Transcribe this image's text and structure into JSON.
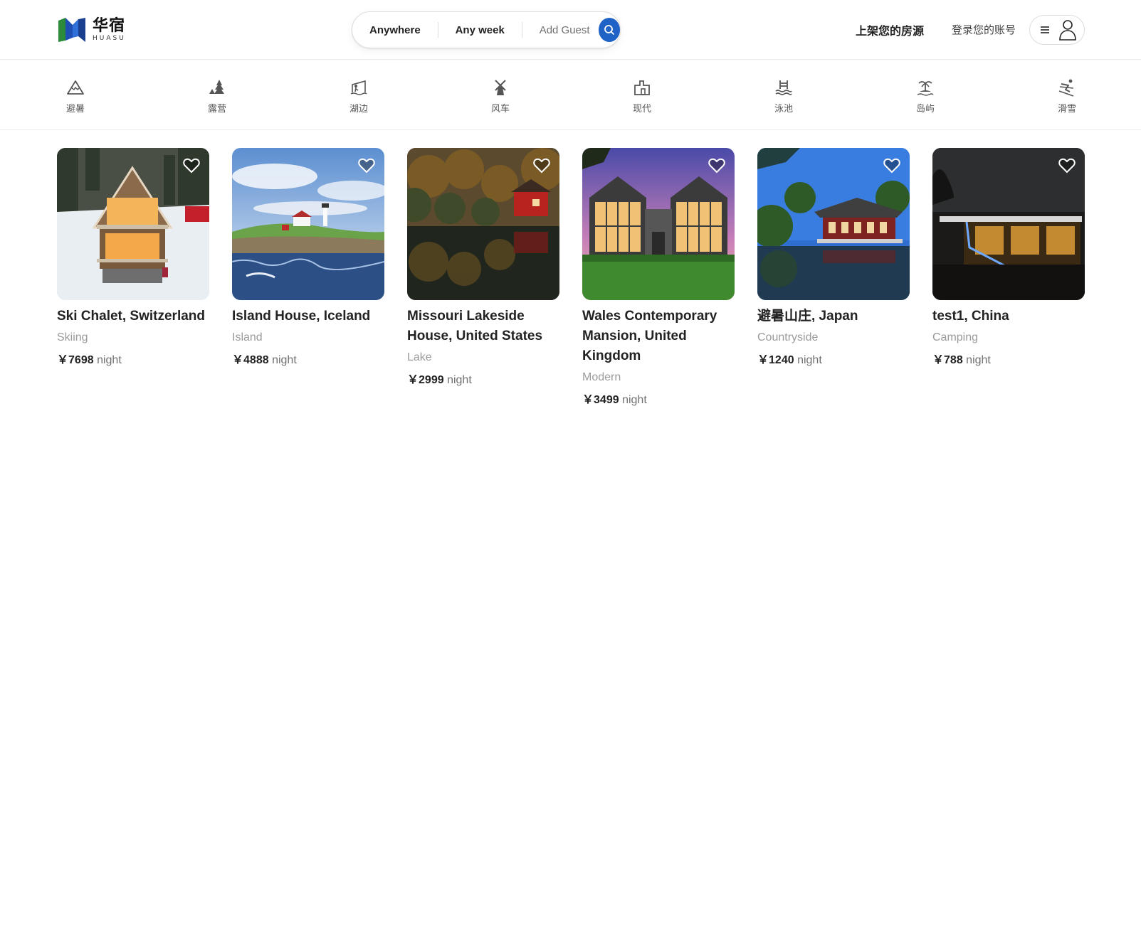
{
  "brand": {
    "name_cn": "华宿",
    "name_en": "HUASU"
  },
  "search": {
    "where": "Anywhere",
    "when": "Any week",
    "guests": "Add Guest"
  },
  "header": {
    "host_link": "上架您的房源",
    "login_link": "登录您的账号"
  },
  "categories": [
    {
      "label": "避暑",
      "icon": "mountain-icon"
    },
    {
      "label": "露营",
      "icon": "tent-tree-icon"
    },
    {
      "label": "湖边",
      "icon": "lake-fishing-icon"
    },
    {
      "label": "风车",
      "icon": "windmill-icon"
    },
    {
      "label": "现代",
      "icon": "modern-building-icon"
    },
    {
      "label": "泳池",
      "icon": "pool-icon"
    },
    {
      "label": "岛屿",
      "icon": "island-icon"
    },
    {
      "label": "滑雪",
      "icon": "skiing-icon"
    }
  ],
  "listings": [
    {
      "title": "Ski Chalet, Switzerland",
      "category": "Skiing",
      "currency": "￥",
      "price": "7698",
      "unit": "night"
    },
    {
      "title": "Island House, Iceland",
      "category": "Island",
      "currency": "￥",
      "price": "4888",
      "unit": "night"
    },
    {
      "title": "Missouri Lakeside House, United States",
      "category": "Lake",
      "currency": "￥",
      "price": "2999",
      "unit": "night"
    },
    {
      "title": "Wales Contemporary Mansion, United Kingdom",
      "category": "Modern",
      "currency": "￥",
      "price": "3499",
      "unit": "night"
    },
    {
      "title": "避暑山庄, Japan",
      "category": "Countryside",
      "currency": "￥",
      "price": "1240",
      "unit": "night"
    },
    {
      "title": "test1, China",
      "category": "Camping",
      "currency": "￥",
      "price": "788",
      "unit": "night"
    }
  ],
  "colors": {
    "accent": "#1f63c6",
    "border": "#dddddd",
    "muted": "#9a9a9a"
  }
}
